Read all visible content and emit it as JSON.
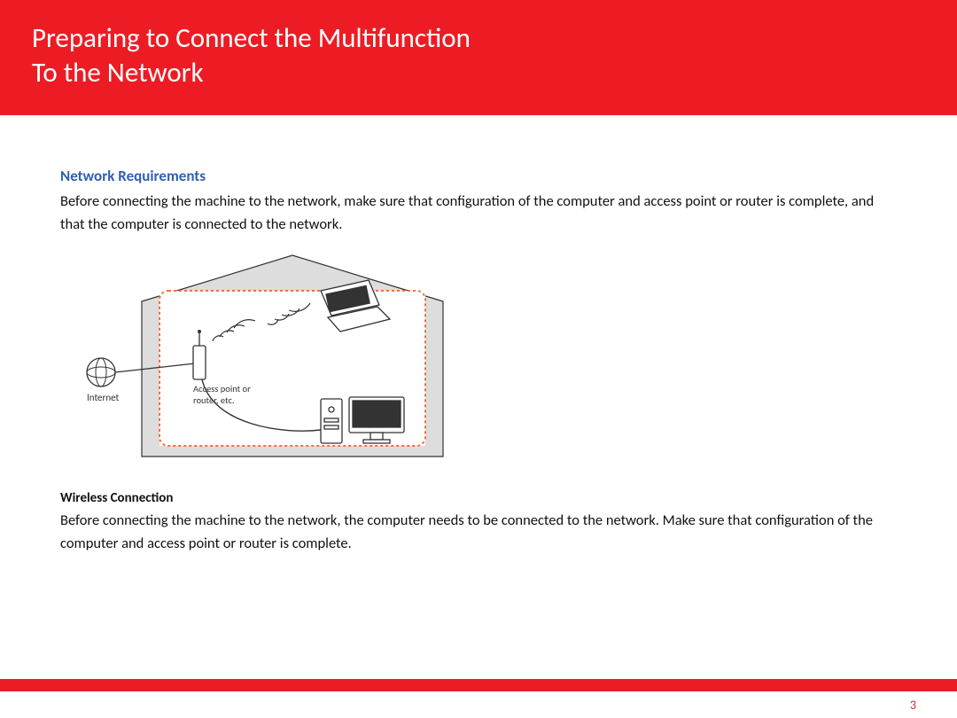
{
  "header": {
    "title_line1": "Preparing to Connect the Multifunction",
    "title_line2": "To the Network"
  },
  "section": {
    "heading": "Network Requirements",
    "intro": "Before connecting the machine to the network, make sure that configuration of the computer and access point or router is complete, and that the computer is connected to the network."
  },
  "diagram": {
    "internet_label": "Internet",
    "ap_label_line1": "Access point or",
    "ap_label_line2": "router, etc."
  },
  "wireless": {
    "heading": "Wireless Connection",
    "body": "Before connecting the machine to the network, the computer needs to be connected to the network. Make sure that configuration of the computer and access point or router is complete."
  },
  "page_number": "3"
}
